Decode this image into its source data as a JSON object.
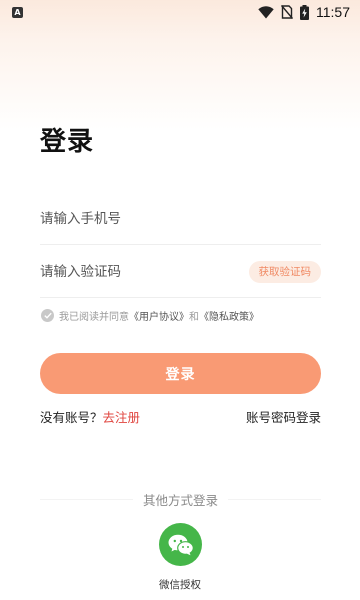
{
  "status_bar": {
    "notification_icon": "A",
    "time": "11:57",
    "icons": [
      "wifi-icon",
      "no-sim-icon",
      "battery-charging-icon"
    ]
  },
  "page": {
    "title": "登录"
  },
  "form": {
    "phone_placeholder": "请输入手机号",
    "code_placeholder": "请输入验证码",
    "get_code_label": "获取验证码"
  },
  "agreement": {
    "prefix": "我已阅读并同意",
    "user_agreement": "《用户协议》",
    "conjunction": "和",
    "privacy_policy": "《隐私政策》"
  },
  "login_button": "登录",
  "register": {
    "prompt": "没有账号？",
    "link": "去注册"
  },
  "password_login": "账号密码登录",
  "other_login": {
    "title": "其他方式登录",
    "wechat_label": "微信授权"
  },
  "colors": {
    "accent": "#f99a74",
    "link_red": "#e0453f",
    "wechat_green": "#45b649",
    "code_button_bg": "#fcece3",
    "code_button_text": "#f08a64"
  }
}
